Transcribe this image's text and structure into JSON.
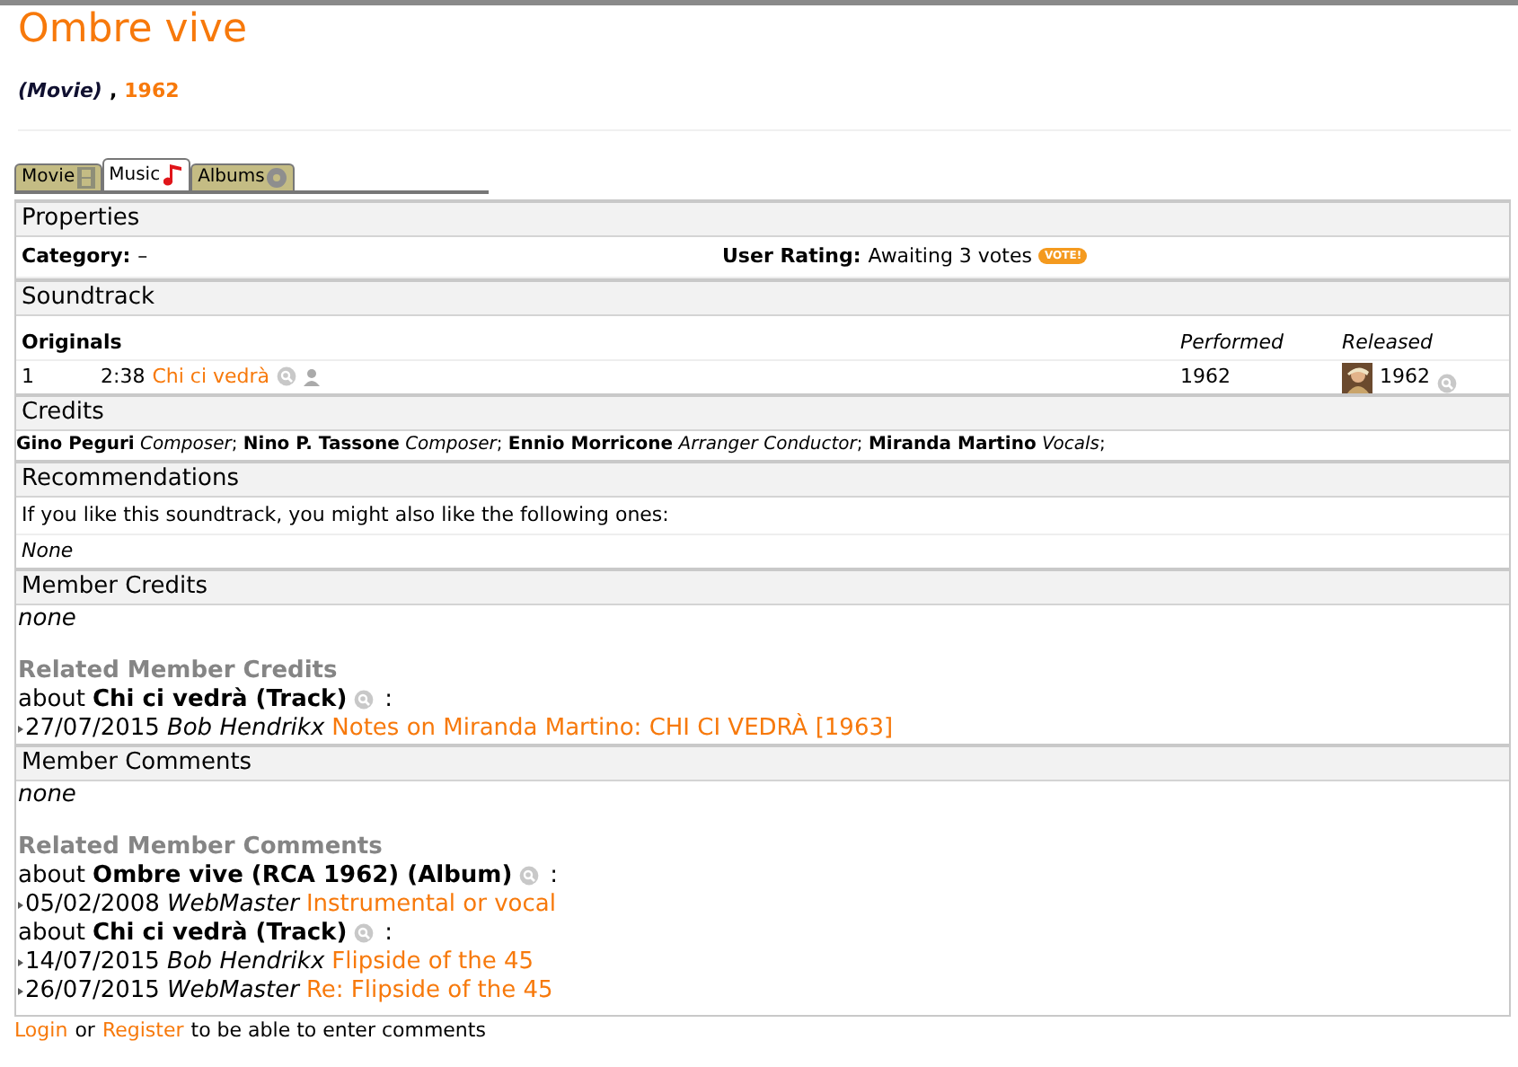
{
  "title": "Ombre vive",
  "subtitle": {
    "kind_label": "(Movie)",
    "separator": ",",
    "year": "1962"
  },
  "tabs": [
    {
      "label": "Movie",
      "kind": "film",
      "selected": false
    },
    {
      "label": "Music",
      "kind": "music",
      "selected": true
    },
    {
      "label": "Albums",
      "kind": "albums",
      "selected": false
    }
  ],
  "properties": {
    "heading": "Properties",
    "category_label": "Category:",
    "category_value": "–",
    "rating_label": "User Rating:",
    "rating_value": "Awaiting 3 votes",
    "vote_badge": "VOTE!"
  },
  "soundtrack": {
    "heading": "Soundtrack",
    "columns": [
      "Originals",
      "Performed",
      "Released"
    ],
    "rows": [
      {
        "number": "1",
        "duration": "2:38",
        "title": "Chi ci vedrà",
        "performed": "1962",
        "released": "1962"
      }
    ]
  },
  "credits": {
    "heading": "Credits",
    "text": "**Gino Peguri** *Composer*; **Nino P. Tassone** *Composer*; **Ennio Morricone** *Arranger Conductor*; **Miranda Martino** *Vocals*;"
  },
  "recommendations": {
    "heading": "Recommendations",
    "intro": "If you like this soundtrack, you might also like the following ones:",
    "empty": "None"
  },
  "member_credits": {
    "heading": "Member Credits",
    "empty": "none",
    "related_heading": "Related Member Credits",
    "groups": [
      {
        "about": "about",
        "subject": "Chi ci vedrà (Track)",
        "colon": ":",
        "entries": [
          {
            "date": "27/07/2015",
            "author": "Bob Hendrikx",
            "link": "Notes on Miranda Martino: CHI CI VEDRÀ [1963]"
          }
        ]
      }
    ]
  },
  "member_comments": {
    "heading": "Member Comments",
    "empty": "none",
    "related_heading": "Related Member Comments",
    "groups": [
      {
        "about": "about",
        "subject": "Ombre vive (RCA 1962) (Album)",
        "colon": ":",
        "entries": [
          {
            "date": "05/02/2008",
            "author": "WebMaster",
            "link": "Instrumental or vocal"
          }
        ]
      },
      {
        "about": "about",
        "subject": "Chi ci vedrà (Track)",
        "colon": ":",
        "entries": [
          {
            "date": "14/07/2015",
            "author": "Bob Hendrikx",
            "link": "Flipside of the 45"
          },
          {
            "date": "26/07/2015",
            "author": "WebMaster",
            "link": "Re: Flipside of the 45"
          }
        ]
      }
    ]
  },
  "footer": {
    "login": "Login",
    "or": "or",
    "register": "Register",
    "rest": "to be able to enter comments"
  }
}
